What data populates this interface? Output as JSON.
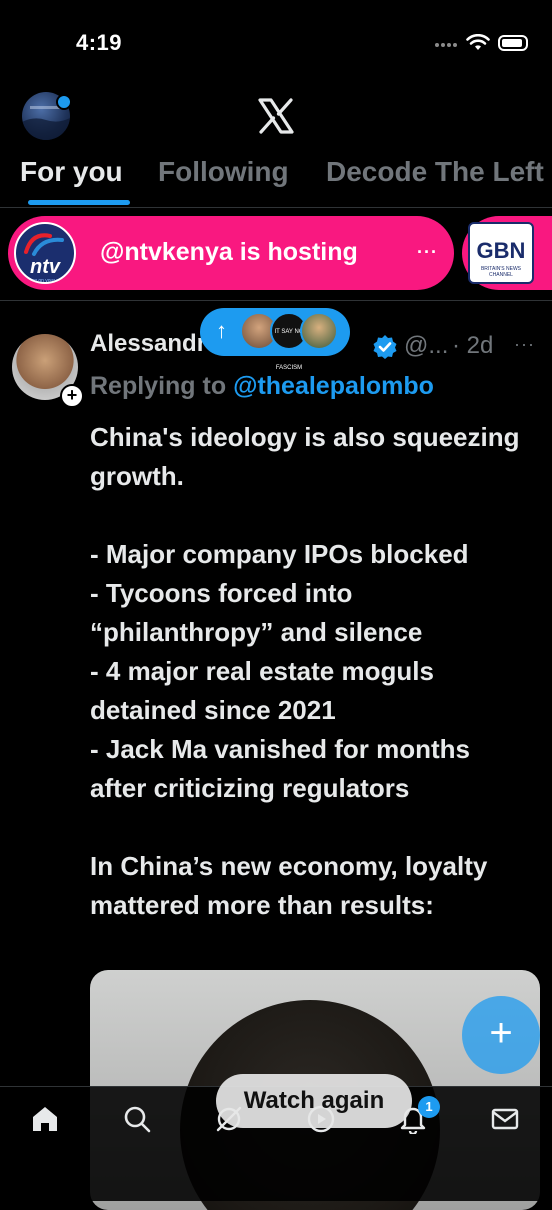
{
  "status_bar": {
    "time": "4:19"
  },
  "tabs": [
    {
      "label": "For you",
      "active": true
    },
    {
      "label": "Following",
      "active": false
    },
    {
      "label": "Decode The Left",
      "active": false
    }
  ],
  "spaces": {
    "primary_label": "@ntvkenya is hosting",
    "more": "···",
    "ntv_logo_text": "ntv",
    "ntv_logo_subtext": "turning on your world",
    "gbn_logo_text": "GBN",
    "gbn_logo_subtext": "BRITAIN'S NEWS CHANNEL"
  },
  "new_posts": {
    "arrow": "↑",
    "avatar_2_text": "IT SAY NO FASCISM"
  },
  "tweet": {
    "author_name": "Alessandro Palombo",
    "handle": "@...",
    "time": "· 2d",
    "more": "···",
    "replying_prefix": "Replying to ",
    "replying_to": "@thealepalombo",
    "text": "China's ideology is also squeezing growth.\n\n- Major company IPOs blocked\n- Tycoons forced into “philanthropy” and silence\n- 4 major real estate moguls detained since 2021\n- Jack Ma vanished for months after criticizing regulators\n\nIn China’s new economy, loyalty mattered more than results:"
  },
  "fab": {
    "label": "+"
  },
  "overlay": {
    "watch_again": "Watch again"
  },
  "notifications": {
    "badge_count": "1"
  },
  "colors": {
    "accent": "#1d9bf0",
    "spaces_pink": "#f91880",
    "background": "#000000",
    "secondary_text": "#71767b"
  }
}
